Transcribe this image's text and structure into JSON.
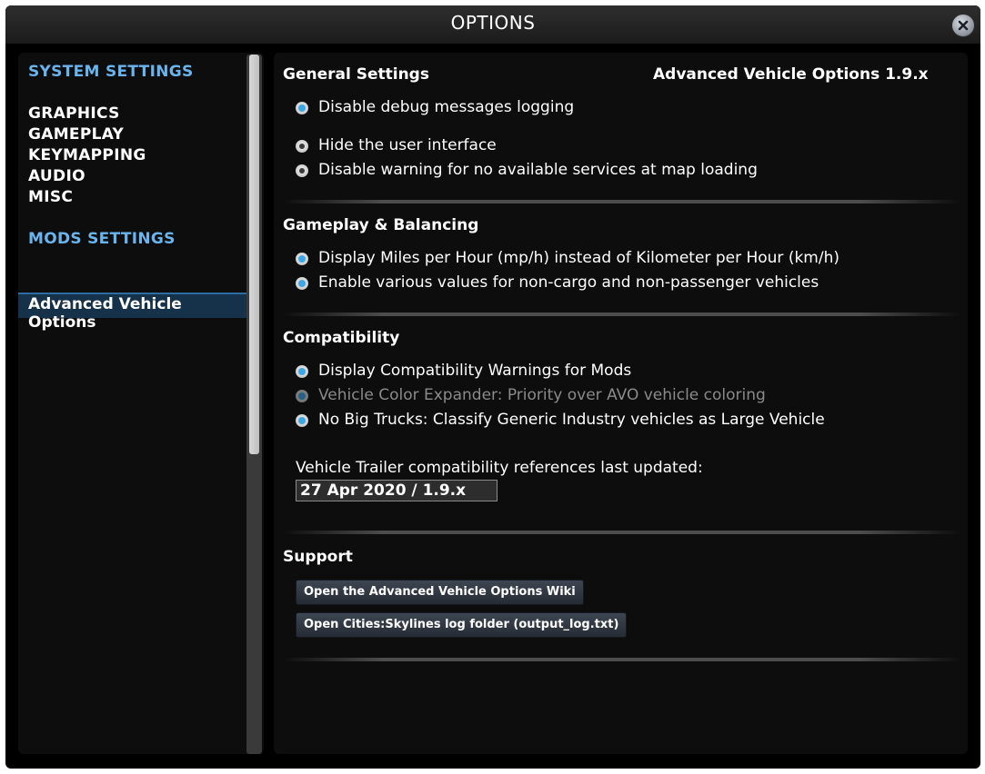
{
  "window": {
    "title": "OPTIONS",
    "close_icon": "close-icon"
  },
  "sidebar": {
    "system_header": "SYSTEM SETTINGS",
    "system_items": [
      {
        "label": "GRAPHICS"
      },
      {
        "label": "GAMEPLAY"
      },
      {
        "label": "KEYMAPPING"
      },
      {
        "label": "AUDIO"
      },
      {
        "label": "MISC"
      }
    ],
    "mods_header": "MODS SETTINGS",
    "mods_items": [
      {
        "label": "Advanced Vehicle Options",
        "selected": true
      }
    ]
  },
  "content": {
    "mod_title": "Advanced Vehicle Options 1.9.x",
    "general": {
      "title": "General Settings",
      "options": [
        {
          "label": "Disable debug messages logging",
          "checked": true
        },
        {
          "label": "Hide the user interface",
          "checked": false
        },
        {
          "label": "Disable warning for no available services at map loading",
          "checked": false
        }
      ]
    },
    "gameplay": {
      "title": "Gameplay & Balancing",
      "options": [
        {
          "label": "Display Miles per Hour (mp/h) instead of Kilometer per Hour (km/h)",
          "checked": true
        },
        {
          "label": "Enable various values for non-cargo and non-passenger vehicles",
          "checked": true
        }
      ]
    },
    "compatibility": {
      "title": "Compatibility",
      "options": [
        {
          "label": "Display Compatibility Warnings for Mods",
          "checked": true,
          "enabled": true
        },
        {
          "label": "Vehicle Color Expander: Priority over AVO vehicle coloring",
          "checked": true,
          "enabled": false
        },
        {
          "label": "No Big Trucks: Classify Generic Industry vehicles as Large Vehicle",
          "checked": true,
          "enabled": true
        }
      ],
      "field_label": "Vehicle Trailer compatibility references last updated:",
      "field_value": "27 Apr 2020 / 1.9.x"
    },
    "support": {
      "title": "Support",
      "buttons": [
        {
          "label": "Open the Advanced Vehicle Options Wiki"
        },
        {
          "label": "Open Cities:Skylines log folder (output_log.txt)"
        }
      ]
    }
  },
  "colors": {
    "accent": "#6ab4ee",
    "radio_on": "#3da7e6",
    "background": "#000000",
    "panel": "#0d0d0d"
  }
}
